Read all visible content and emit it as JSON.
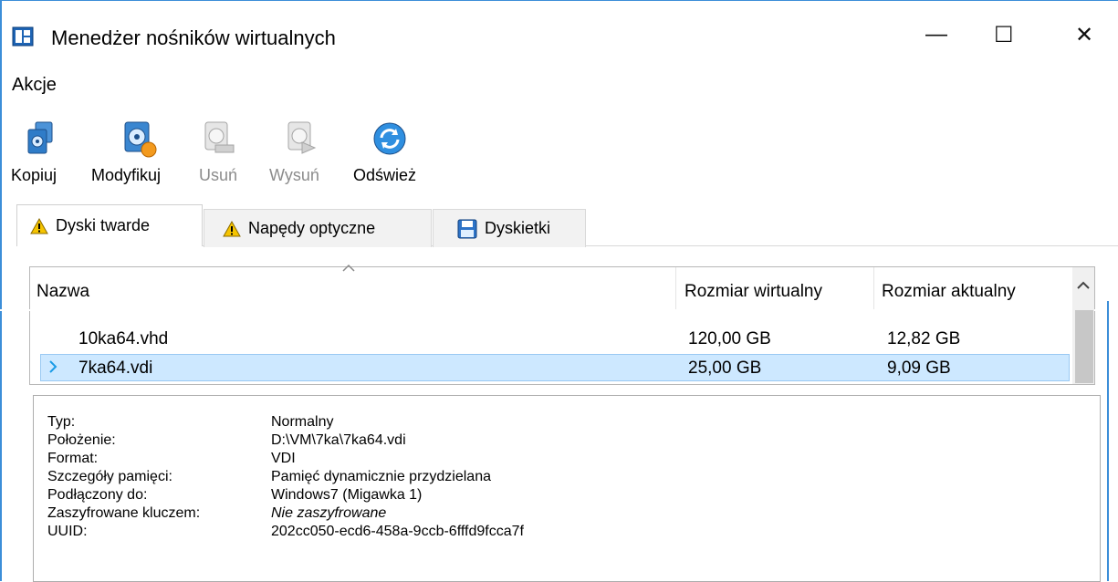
{
  "window": {
    "title": "Menedżer nośników wirtualnych",
    "minimize": "—",
    "maximize": "☐",
    "close": "✕"
  },
  "menu": {
    "actions": "Akcje"
  },
  "toolbar": {
    "copy": "Kopiuj",
    "modify": "Modyfikuj",
    "remove": "Usuń",
    "eject": "Wysuń",
    "refresh": "Odśwież"
  },
  "tabs": {
    "hard_disks": "Dyski twarde",
    "optical": "Napędy optyczne",
    "floppy": "Dyskietki"
  },
  "table": {
    "columns": {
      "name": "Nazwa",
      "virtual_size": "Rozmiar wirtualny",
      "actual_size": "Rozmiar aktualny"
    },
    "rows": [
      {
        "name": "10ka64.vhd",
        "virtual_size": "120,00 GB",
        "actual_size": "12,82 GB"
      },
      {
        "name": "7ka64.vdi",
        "virtual_size": "25,00 GB",
        "actual_size": "9,09 GB"
      }
    ]
  },
  "details": {
    "type_label": "Typ:",
    "type_value": "Normalny",
    "location_label": "Położenie:",
    "location_value": "D:\\VM\\7ka\\7ka64.vdi",
    "format_label": "Format:",
    "format_value": "VDI",
    "storage_label": "Szczegóły pamięci:",
    "storage_value": "Pamięć dynamicznie przydzielana",
    "attached_label": "Podłączony do:",
    "attached_value": "Windows7 (Migawka 1)",
    "encrypted_label": "Zaszyfrowane kluczem:",
    "encrypted_value": "Nie zaszyfrowane",
    "uuid_label": "UUID:",
    "uuid_value": "202cc050-ecd6-458a-9ccb-6fffd9fcca7f"
  }
}
